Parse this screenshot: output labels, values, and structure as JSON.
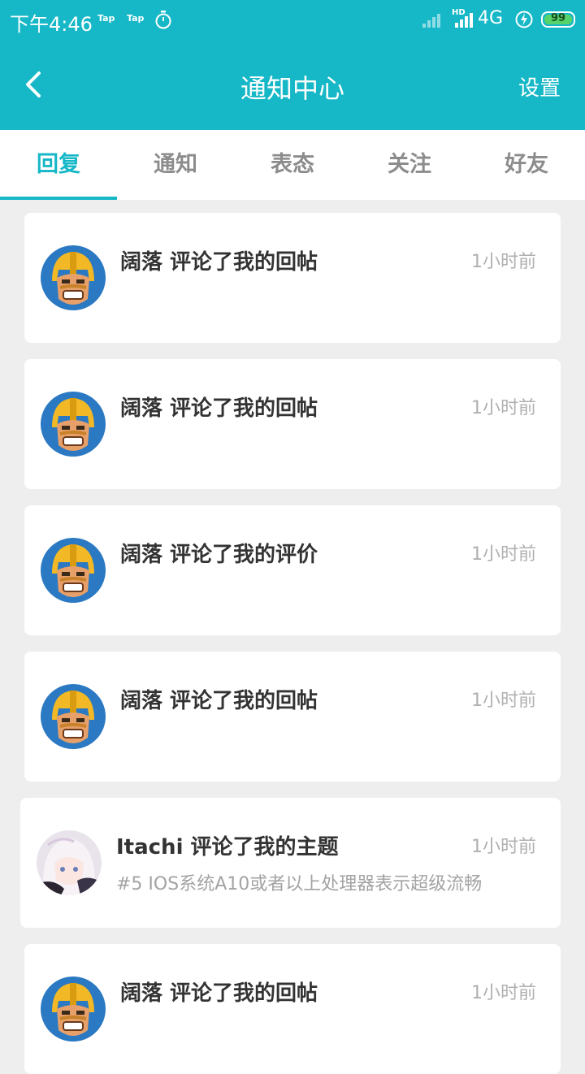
{
  "status_bar": {
    "time": "下午4:46",
    "tap1": "Tap",
    "tap2": "Tap",
    "network": "4G",
    "hd": "HD",
    "battery": "99"
  },
  "header": {
    "title": "通知中心",
    "settings_label": "设置",
    "background": "#16b8c7"
  },
  "tabs": [
    {
      "label": "回复",
      "active": true
    },
    {
      "label": "通知",
      "active": false
    },
    {
      "label": "表态",
      "active": false
    },
    {
      "label": "关注",
      "active": false
    },
    {
      "label": "好友",
      "active": false
    }
  ],
  "notifications": [
    {
      "title": "阔落 评论了我的回帖",
      "time": "1小时前",
      "avatar": "barbarian-avatar"
    },
    {
      "title": "阔落 评论了我的回帖",
      "time": "1小时前",
      "avatar": "barbarian-avatar"
    },
    {
      "title": "阔落 评论了我的评价",
      "time": "1小时前",
      "avatar": "barbarian-avatar"
    },
    {
      "title": "阔落 评论了我的回帖",
      "time": "1小时前",
      "avatar": "barbarian-avatar"
    },
    {
      "title": "Itachi 评论了我的主题",
      "time": "1小时前",
      "subtitle": "#5 IOS系统A10或者以上处理器表示超级流畅",
      "avatar": "anime-girl-avatar"
    },
    {
      "title": "阔落 评论了我的回帖",
      "time": "1小时前",
      "avatar": "barbarian-avatar"
    }
  ]
}
